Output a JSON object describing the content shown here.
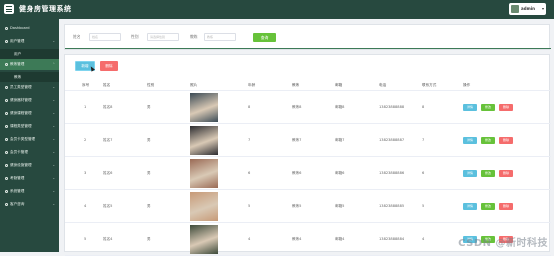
{
  "app": {
    "title": "健身房管理系统",
    "user": "admin"
  },
  "sidebar": [
    {
      "label": "Dashboard",
      "icon": "dashboard-icon"
    },
    {
      "label": "用户管理",
      "icon": "user-icon",
      "chevron": "⌄"
    },
    {
      "label": "用户",
      "sub": true
    },
    {
      "label": "教练管理",
      "icon": "coach-icon",
      "chevron": "⌃",
      "active": true
    },
    {
      "label": "教练",
      "sub": true
    },
    {
      "label": "员工类型管理",
      "icon": "staff-type-icon",
      "chevron": "⌄"
    },
    {
      "label": "健身器材管理",
      "icon": "equipment-icon",
      "chevron": "⌄"
    },
    {
      "label": "健身课程管理",
      "icon": "course-icon",
      "chevron": "⌄"
    },
    {
      "label": "课程类型管理",
      "icon": "course-type-icon",
      "chevron": "⌄"
    },
    {
      "label": "会员卡类型管理",
      "icon": "card-type-icon",
      "chevron": "⌄"
    },
    {
      "label": "会员卡管理",
      "icon": "card-icon",
      "chevron": "⌄"
    },
    {
      "label": "健身设施管理",
      "icon": "facility-icon",
      "chevron": "⌄"
    },
    {
      "label": "考勤管理",
      "icon": "attendance-icon",
      "chevron": "⌄"
    },
    {
      "label": "系统管理",
      "icon": "system-icon",
      "chevron": "⌄"
    },
    {
      "label": "客户咨询",
      "icon": "consult-icon",
      "chevron": "⌄"
    }
  ],
  "search": {
    "fields": [
      {
        "label": "姓名",
        "placeholder": "姓名"
      },
      {
        "label": "性别",
        "placeholder": "请选择性别"
      },
      {
        "label": "教练",
        "placeholder": "教练"
      }
    ],
    "button": "查询"
  },
  "actions": {
    "add": "新增",
    "delete": "删除"
  },
  "table": {
    "headers": [
      "序号",
      "姓名",
      "性别",
      "照片",
      "年龄",
      "教练",
      "邮箱",
      "电话",
      "联系方式",
      "操作"
    ],
    "row_buttons": {
      "detail": "详情",
      "edit": "修改",
      "delete": "删除"
    },
    "rows": [
      {
        "index": "1",
        "name": "姓名8",
        "gender": "男",
        "age": "8",
        "coach": "教练8",
        "email": "邮箱8",
        "phone": "13823888888",
        "contact": "8",
        "photo_tone": "#3a4a55"
      },
      {
        "index": "2",
        "name": "姓名7",
        "gender": "男",
        "age": "7",
        "coach": "教练7",
        "email": "邮箱7",
        "phone": "13823888887",
        "contact": "7",
        "photo_tone": "#2c2c30"
      },
      {
        "index": "3",
        "name": "姓名6",
        "gender": "男",
        "age": "6",
        "coach": "教练6",
        "email": "邮箱6",
        "phone": "13823888886",
        "contact": "6",
        "photo_tone": "#9a6a55"
      },
      {
        "index": "4",
        "name": "姓名5",
        "gender": "男",
        "age": "5",
        "coach": "教练5",
        "email": "邮箱5",
        "phone": "13823888885",
        "contact": "5",
        "photo_tone": "#c79a77"
      },
      {
        "index": "5",
        "name": "姓名4",
        "gender": "男",
        "age": "4",
        "coach": "教练4",
        "email": "邮箱4",
        "phone": "13823888884",
        "contact": "4",
        "photo_tone": "#3d4a3a"
      }
    ]
  },
  "watermark": "CSDN @新时科技",
  "colors": {
    "header": "#27493f",
    "active": "#3d7a57",
    "search": "#67c23a",
    "detail": "#5bc0de",
    "delete": "#f56c6c"
  }
}
